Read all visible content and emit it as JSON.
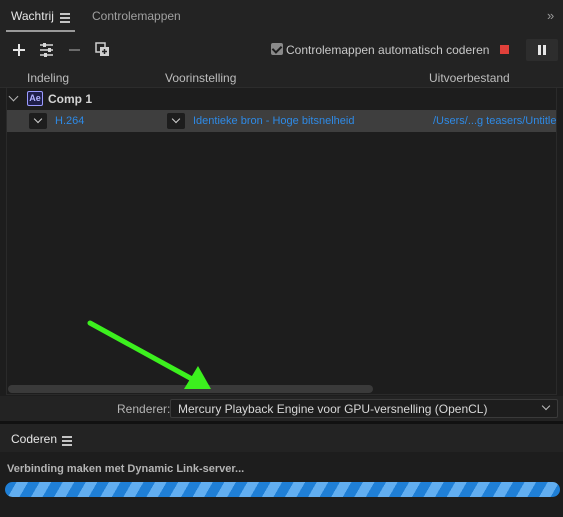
{
  "tabs": {
    "queue_label": "Wachtrij",
    "watch_label": "Controlemappen"
  },
  "toolbar": {
    "auto_encode_label": "Controlemappen automatisch coderen",
    "auto_encode_checked": true,
    "icons": [
      "plus-icon",
      "settings-sliders-icon",
      "minus-icon",
      "duplicate-icon",
      "stop-icon",
      "pause-icon"
    ]
  },
  "columns": {
    "format": "Indeling",
    "preset": "Voorinstelling",
    "output": "Uitvoerbestand"
  },
  "queue": {
    "comp": {
      "badge": "Ae",
      "name": "Comp 1"
    },
    "output": {
      "format": "H.264",
      "preset": "Identieke bron - Hoge bitsnelheid",
      "file": "/Users/...g teasers/Untitled"
    }
  },
  "renderer": {
    "label": "Renderer:",
    "value": "Mercury Playback Engine voor GPU-versnelling (OpenCL)"
  },
  "encoding": {
    "title": "Coderen",
    "status": "Verbinding maken met Dynamic Link-server...",
    "progress_state": "indeterminate"
  },
  "colors": {
    "link": "#2e8ae6",
    "stop": "#e0403a",
    "progress": "#1f7fd6",
    "arrow": "#3cf01e",
    "background": "#1d1d1d"
  }
}
